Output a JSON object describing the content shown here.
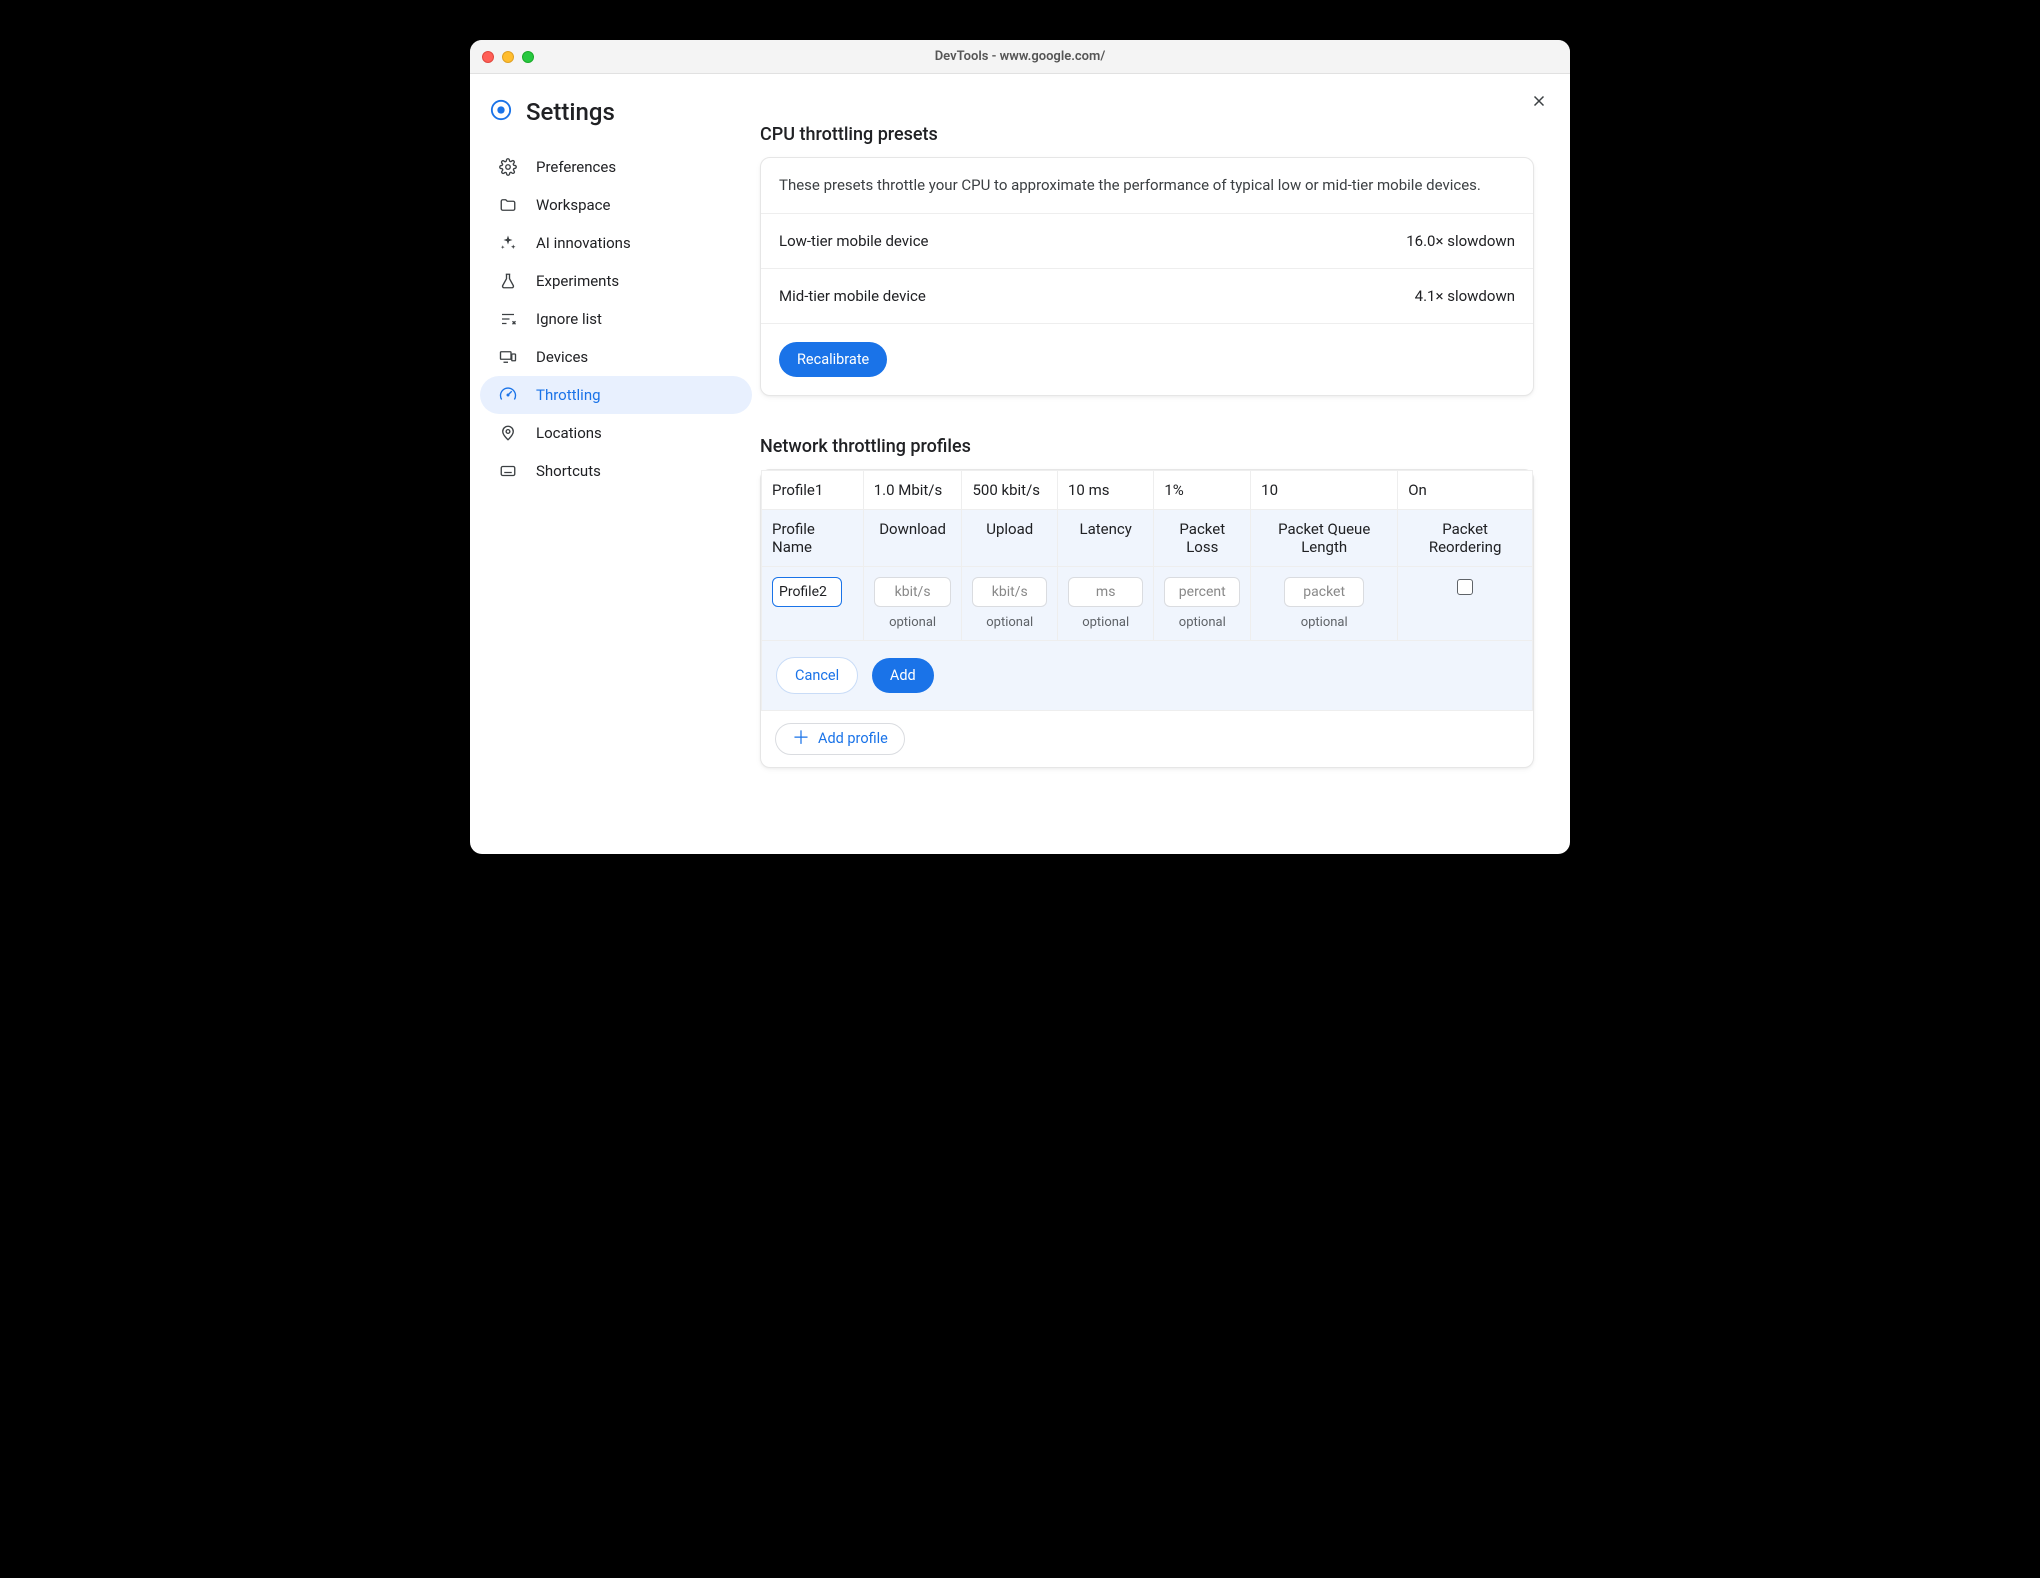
{
  "window_title": "DevTools - www.google.com/",
  "page_title": "Settings",
  "sidebar": {
    "items": [
      {
        "label": "Preferences",
        "icon": "gear-icon",
        "active": false
      },
      {
        "label": "Workspace",
        "icon": "folder-icon",
        "active": false
      },
      {
        "label": "AI innovations",
        "icon": "sparkle-icon",
        "active": false
      },
      {
        "label": "Experiments",
        "icon": "flask-icon",
        "active": false
      },
      {
        "label": "Ignore list",
        "icon": "filter-icon",
        "active": false
      },
      {
        "label": "Devices",
        "icon": "devices-icon",
        "active": false
      },
      {
        "label": "Throttling",
        "icon": "speed-icon",
        "active": true
      },
      {
        "label": "Locations",
        "icon": "location-icon",
        "active": false
      },
      {
        "label": "Shortcuts",
        "icon": "keyboard-icon",
        "active": false
      }
    ]
  },
  "cpu_section": {
    "heading": "CPU throttling presets",
    "description": "These presets throttle your CPU to approximate the performance of typical low or mid-tier mobile devices.",
    "presets": [
      {
        "name": "Low-tier mobile device",
        "value": "16.0× slowdown"
      },
      {
        "name": "Mid-tier mobile device",
        "value": "4.1× slowdown"
      }
    ],
    "recalibrate_label": "Recalibrate"
  },
  "network_section": {
    "heading": "Network throttling profiles",
    "columns": {
      "name": "Profile Name",
      "download": "Download",
      "upload": "Upload",
      "latency": "Latency",
      "packet_loss": "Packet Loss",
      "queue": "Packet Queue Length",
      "reorder": "Packet Reordering"
    },
    "rows": [
      {
        "name": "Profile1",
        "download": "1.0 Mbit/s",
        "upload": "500 kbit/s",
        "latency": "10 ms",
        "packet_loss": "1%",
        "queue": "10",
        "reorder": "On"
      }
    ],
    "edit": {
      "name_value": "Profile2",
      "placeholders": {
        "download": "kbit/s",
        "upload": "kbit/s",
        "latency": "ms",
        "packet_loss": "percent",
        "queue": "packet"
      },
      "optional_hint": "optional",
      "cancel_label": "Cancel",
      "add_label": "Add"
    },
    "add_profile_label": "Add profile"
  }
}
